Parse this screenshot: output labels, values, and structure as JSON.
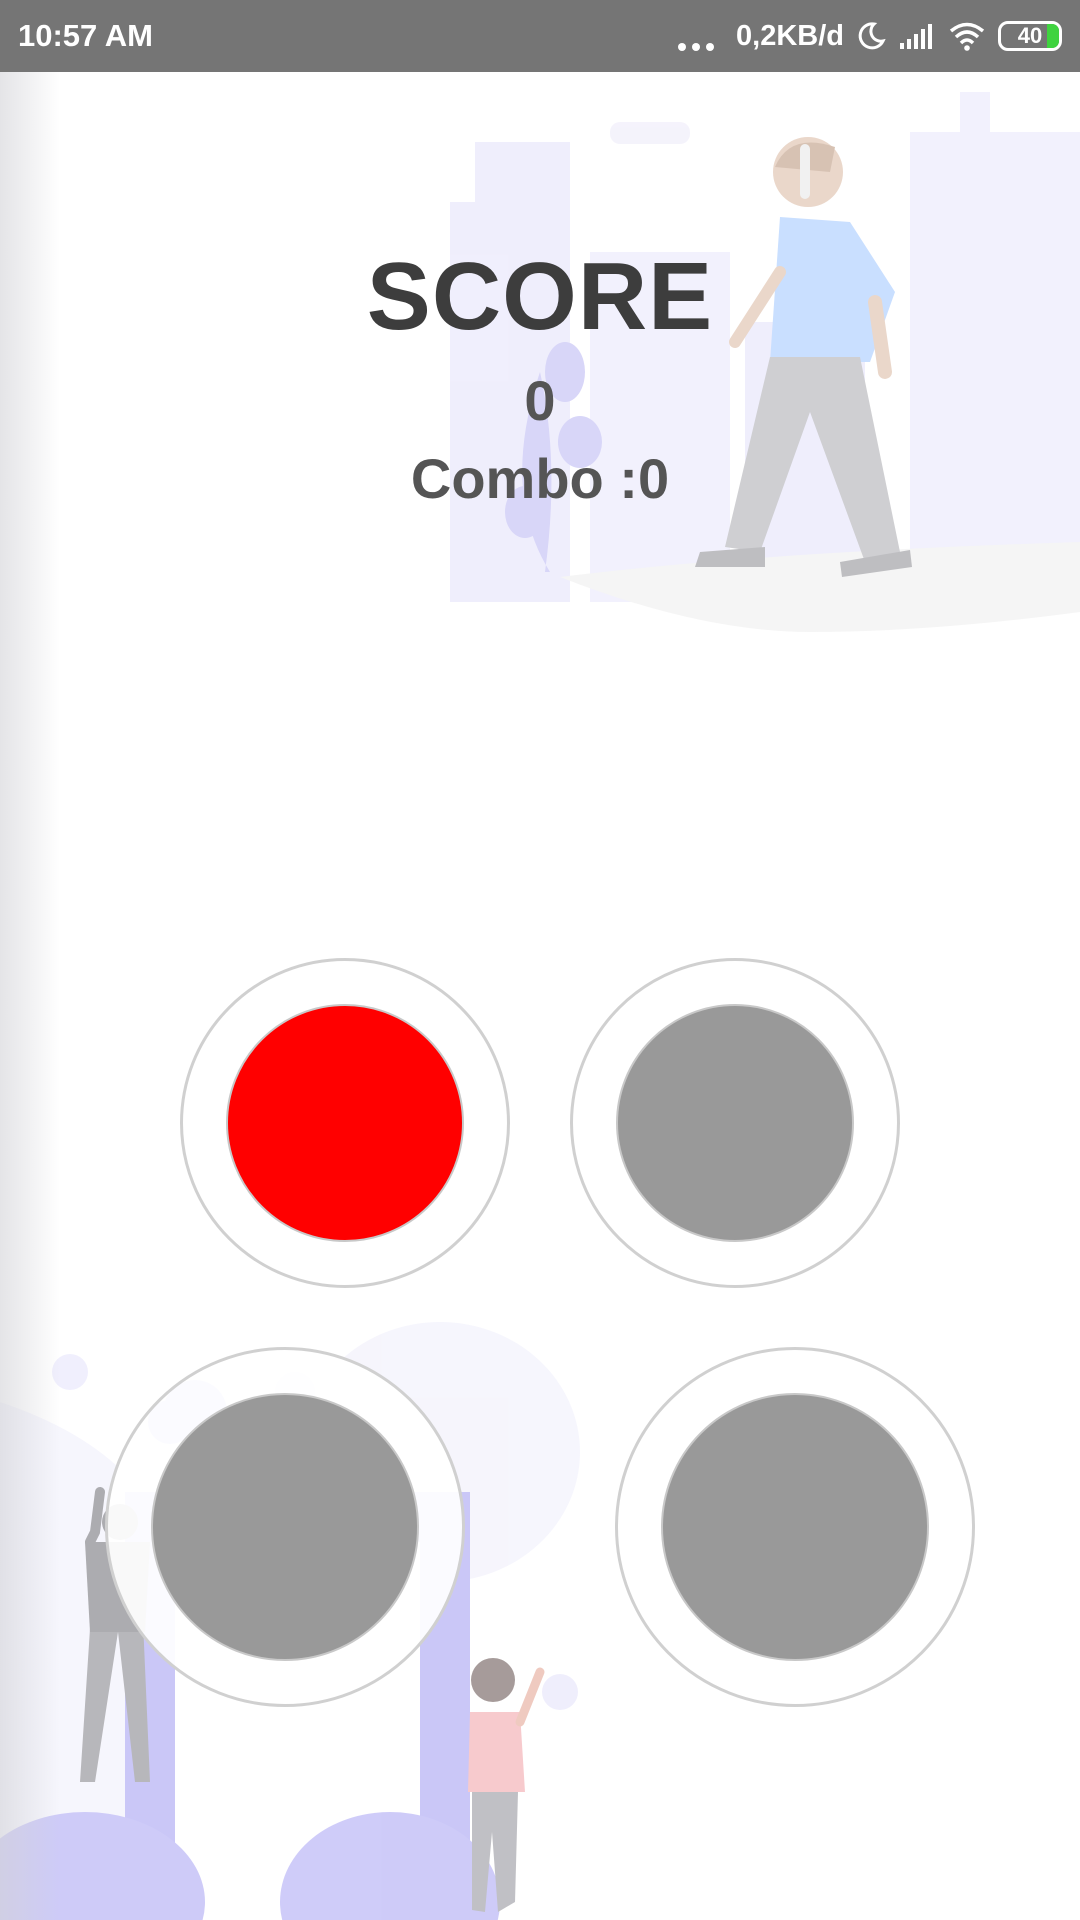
{
  "status_bar": {
    "time": "10:57 AM",
    "data_rate": "0,2KB/d",
    "battery": "40",
    "icons": [
      "more-dots-icon",
      "moon-icon",
      "signal-icon",
      "wifi-icon",
      "battery-icon"
    ]
  },
  "score": {
    "title": "SCORE",
    "value": "0",
    "combo": "Combo :0"
  },
  "pads": [
    {
      "name": "top-left",
      "state": "active",
      "color": "#ff0000"
    },
    {
      "name": "top-right",
      "state": "idle",
      "color": "#999999"
    },
    {
      "name": "bottom-left",
      "state": "idle",
      "color": "#999999"
    },
    {
      "name": "bottom-right",
      "state": "idle",
      "color": "#999999"
    }
  ],
  "colors": {
    "status_bar": "#757575",
    "text": "#3d3d3d",
    "active_pad": "#ff0000",
    "idle_pad": "#999999",
    "illustration_purple": "#cfcdfb"
  }
}
